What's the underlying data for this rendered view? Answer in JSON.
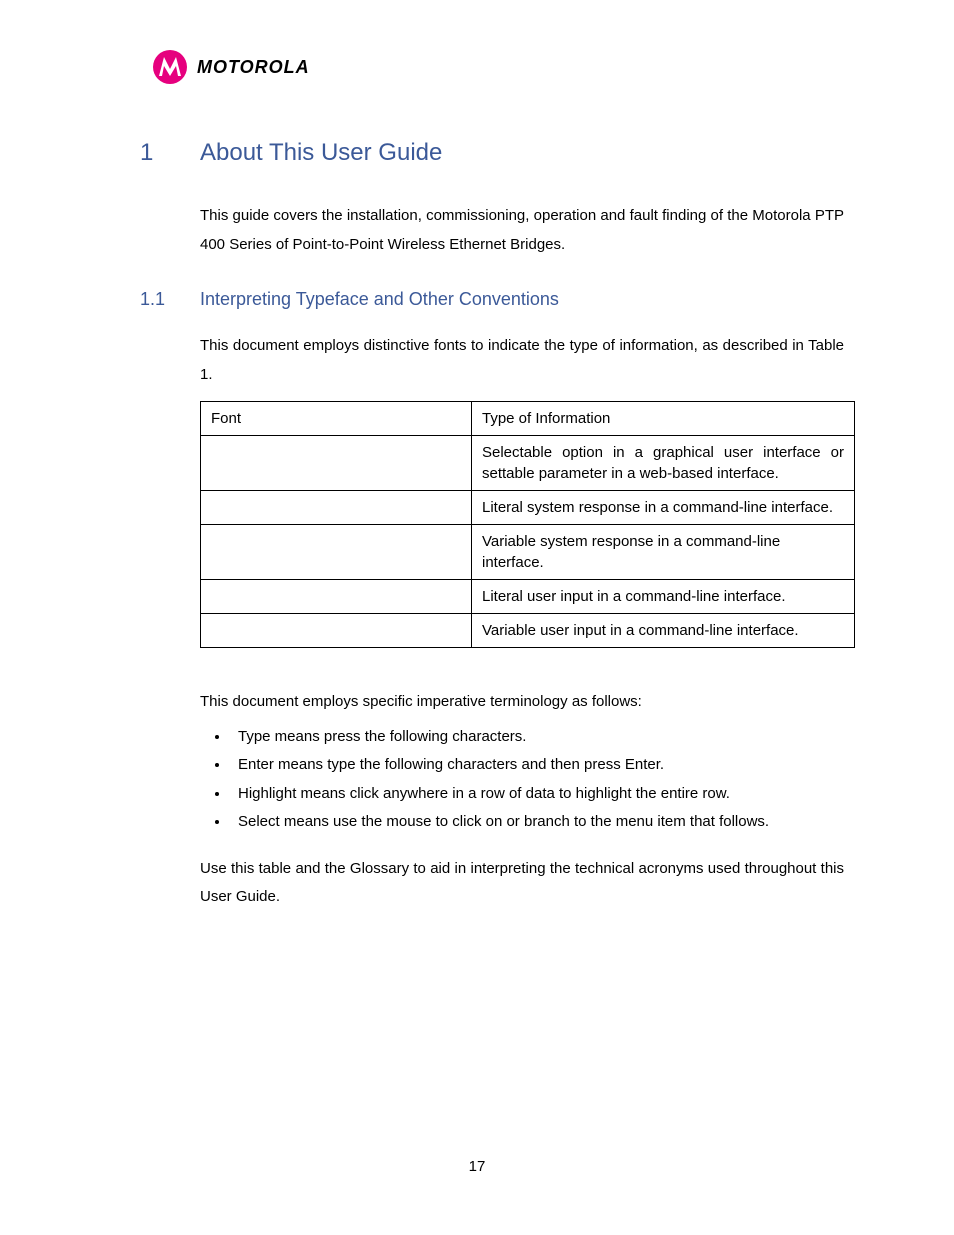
{
  "header": {
    "brand": "MOTOROLA"
  },
  "section": {
    "number": "1",
    "title": "About This User Guide",
    "intro": "This guide covers the installation, commissioning, operation and fault finding of the Motorola PTP 400 Series of Point-to-Point Wireless Ethernet Bridges."
  },
  "subsection": {
    "number": "1.1",
    "title": "Interpreting Typeface and Other Conventions",
    "intro": "This document employs distinctive fonts to indicate the type of information, as described in Table 1."
  },
  "table": {
    "header_font": "Font",
    "header_type": "Type of Information",
    "rows": [
      {
        "font": "",
        "type": "Selectable option in a graphical user interface or settable parameter in a web-based interface."
      },
      {
        "font": "",
        "type": "Literal system response in a command-line interface."
      },
      {
        "font": "",
        "type": "Variable system response in a command-line interface."
      },
      {
        "font": "",
        "type": "Literal user input in a command-line interface."
      },
      {
        "font": "",
        "type": "Variable user input in a command-line interface."
      }
    ]
  },
  "terminology": {
    "intro": "This document employs specific imperative terminology as follows:",
    "items": [
      "Type means press the following characters.",
      "Enter means type the following characters and then press Enter.",
      "Highlight means click anywhere in a row of data to highlight the entire row.",
      "Select means use the mouse to click on or branch to the menu item that follows."
    ],
    "closing": "Use this table and the Glossary to aid in interpreting the technical acronyms used throughout this User Guide."
  },
  "page_number": "17"
}
